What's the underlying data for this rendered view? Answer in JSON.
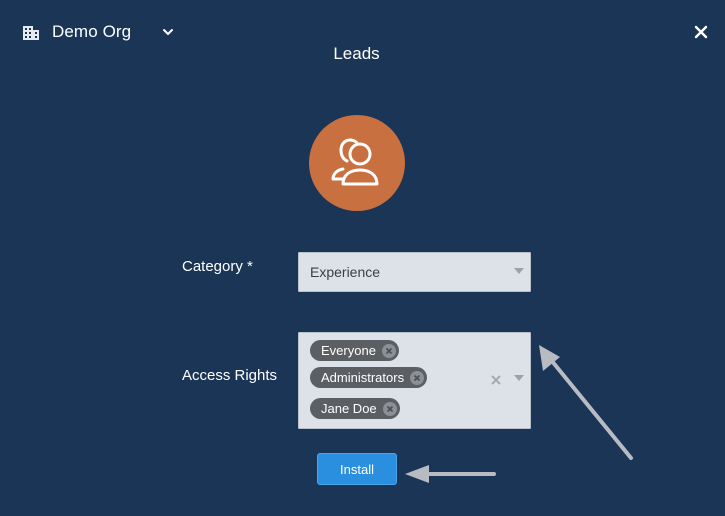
{
  "header": {
    "org_name": "Demo Org",
    "org_icon": "building-icon",
    "dropdown_icon": "chevron-down-icon",
    "close_icon": "close-icon"
  },
  "page": {
    "title": "Leads",
    "avatar_icon": "users-icon",
    "avatar_color": "#c8703f",
    "background_color": "#1b3556"
  },
  "form": {
    "category": {
      "label": "Category *",
      "value": "Experience"
    },
    "access_rights": {
      "label": "Access Rights",
      "tags": [
        "Everyone",
        "Administrators",
        "Jane Doe"
      ]
    },
    "install_label": "Install",
    "install_color": "#2a8fde"
  }
}
